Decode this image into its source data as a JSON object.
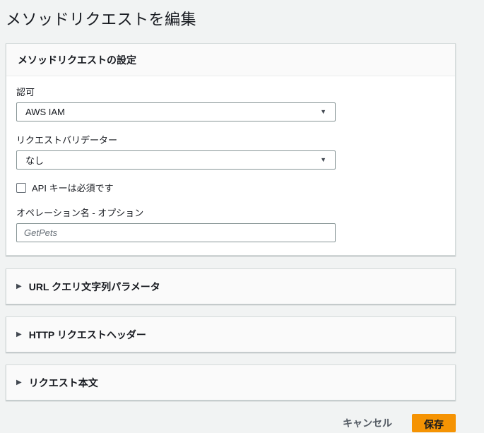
{
  "page": {
    "title": "メソッドリクエストを編集"
  },
  "settings_panel": {
    "title": "メソッドリクエストの設定",
    "authorization": {
      "label": "認可",
      "value": "AWS IAM"
    },
    "request_validator": {
      "label": "リクエストバリデーター",
      "value": "なし"
    },
    "api_key": {
      "label": "API キーは必須です",
      "checked": false
    },
    "operation_name": {
      "label": "オペレーション名 - オプション",
      "value": "",
      "placeholder": "GetPets"
    }
  },
  "sections": [
    {
      "label": "URL クエリ文字列パラメータ"
    },
    {
      "label": "HTTP リクエストヘッダー"
    },
    {
      "label": "リクエスト本文"
    }
  ],
  "footer": {
    "cancel_label": "キャンセル",
    "save_label": "保存"
  },
  "icons": {
    "dropdown_arrow": "▼",
    "expand_caret": "▶"
  },
  "colors": {
    "page_background": "#f1f3f3",
    "panel_background": "#ffffff",
    "panel_header_background": "#fafafa",
    "border": "#d5dbdb",
    "control_border": "#879596",
    "text": "#16191f",
    "secondary_text": "#545b64",
    "accent_orange": "#f59303"
  }
}
